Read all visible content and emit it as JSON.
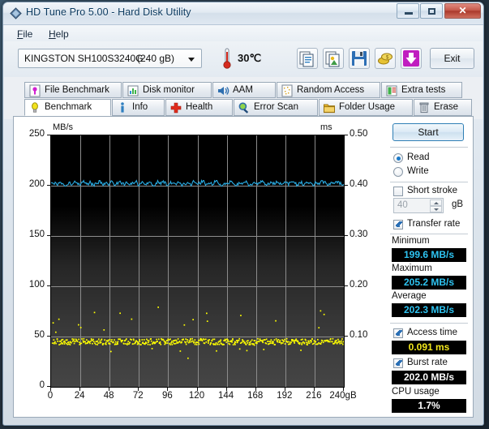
{
  "window": {
    "title": "HD Tune Pro 5.00 - Hard Disk Utility",
    "icon": "hdtune-logo-icon",
    "minimize_label": "",
    "maximize_label": "",
    "close_label": "✕"
  },
  "menu": {
    "items": [
      {
        "label": "File",
        "accel": "F"
      },
      {
        "label": "Help",
        "accel": "H"
      }
    ]
  },
  "toolbar": {
    "drive_name": "KINGSTON SH100S3240G",
    "drive_capacity": "(240 gB)",
    "temperature": "30℃",
    "thermometer_icon": "thermometer-icon",
    "buttons": [
      {
        "name": "copy-text-icon",
        "label": ""
      },
      {
        "name": "copy-image-icon",
        "label": ""
      },
      {
        "name": "save-icon",
        "label": ""
      },
      {
        "name": "coins-icon",
        "label": ""
      },
      {
        "name": "download-arrow-icon",
        "label": ""
      }
    ],
    "exit_label": "Exit"
  },
  "tabs": {
    "row1": [
      {
        "label": "File Benchmark",
        "icon": "file-benchmark-icon",
        "active": false
      },
      {
        "label": "Disk monitor",
        "icon": "disk-monitor-icon",
        "active": false
      },
      {
        "label": "AAM",
        "icon": "speaker-icon",
        "active": false
      },
      {
        "label": "Random Access",
        "icon": "random-access-icon",
        "active": false
      },
      {
        "label": "Extra tests",
        "icon": "extra-tests-icon",
        "active": false
      }
    ],
    "row2": [
      {
        "label": "Benchmark",
        "icon": "benchmark-bulb-icon",
        "active": true
      },
      {
        "label": "Info",
        "icon": "info-icon",
        "active": false
      },
      {
        "label": "Health",
        "icon": "health-cross-icon",
        "active": false
      },
      {
        "label": "Error Scan",
        "icon": "magnifier-icon",
        "active": false
      },
      {
        "label": "Folder Usage",
        "icon": "folder-icon",
        "active": false
      },
      {
        "label": "Erase",
        "icon": "trash-icon",
        "active": false
      }
    ]
  },
  "results": {
    "start_label": "Start",
    "mode": {
      "read_label": "Read",
      "write_label": "Write",
      "selected": "Read"
    },
    "short_stroke": {
      "label": "Short stroke",
      "checked": false,
      "value": "40",
      "unit": "gB"
    },
    "transfer_rate": {
      "label": "Transfer rate",
      "checked": true,
      "minimum_label": "Minimum",
      "minimum_value": "199.6 MB/s",
      "maximum_label": "Maximum",
      "maximum_value": "205.2 MB/s",
      "average_label": "Average",
      "average_value": "202.3 MB/s"
    },
    "access_time": {
      "label": "Access time",
      "checked": true,
      "value": "0.091 ms"
    },
    "burst_rate": {
      "label": "Burst rate",
      "checked": true,
      "value": "202.0 MB/s"
    },
    "cpu_usage": {
      "label": "CPU usage",
      "value": "1.7%"
    }
  },
  "colors": {
    "transfer_line": "#29abe2",
    "access_dots": "#ffff00",
    "value_cyan": "#2ec4f2",
    "value_yellow": "#f2e71c",
    "value_white": "#ffffff",
    "plot_background": "#000000",
    "gridline": "#8c8c8c"
  },
  "chart_data": {
    "type": "line",
    "title": "",
    "xlabel": "240gB",
    "ylabel": "MB/s",
    "y2label": "ms",
    "xlim": [
      0,
      240
    ],
    "ylim": [
      0,
      250
    ],
    "y2lim": [
      0,
      0.5
    ],
    "grid": true,
    "legend": "none",
    "xticks": [
      0,
      24,
      48,
      72,
      96,
      120,
      144,
      168,
      192,
      216,
      240
    ],
    "xticklabels": [
      "0",
      "24",
      "48",
      "72",
      "96",
      "120",
      "144",
      "168",
      "192",
      "216",
      "240gB"
    ],
    "yticks": [
      0,
      50,
      100,
      150,
      200,
      250
    ],
    "yticklabels": [
      "0",
      "50",
      "100",
      "150",
      "200",
      "250"
    ],
    "y2ticks": [
      0.1,
      0.2,
      0.3,
      0.4,
      0.5
    ],
    "y2ticklabels": [
      "0.10",
      "0.20",
      "0.30",
      "0.40",
      "0.50"
    ],
    "series": [
      {
        "name": "Transfer rate",
        "type": "line",
        "axis": "left",
        "unit": "MB/s",
        "color": "#29abe2",
        "minimum": 199.6,
        "maximum": 205.2,
        "average": 202.3,
        "x": [
          0,
          2,
          5,
          7,
          10,
          12,
          15,
          17,
          20,
          22,
          25,
          27,
          30,
          32,
          35,
          37,
          40,
          42,
          45,
          47,
          50,
          52,
          55,
          57,
          60,
          62,
          65,
          67,
          70,
          72,
          75,
          77,
          80,
          82,
          85,
          87,
          90,
          92,
          95,
          97,
          100,
          102,
          105,
          107,
          110,
          112,
          115,
          117,
          120,
          122,
          125,
          127,
          130,
          132,
          135,
          137,
          140,
          142,
          145,
          147,
          150,
          152,
          155,
          157,
          160,
          162,
          165,
          167,
          170,
          172,
          175,
          177,
          180,
          182,
          185,
          187,
          190,
          192,
          195,
          197,
          200,
          202,
          205,
          207,
          210,
          212,
          215,
          217,
          220,
          222,
          225,
          227,
          230,
          232,
          235,
          237,
          240
        ],
        "values": [
          201.8,
          203.4,
          200.9,
          204.1,
          202.0,
          199.8,
          203.8,
          201.2,
          204.6,
          200.4,
          202.7,
          205.0,
          201.1,
          203.2,
          199.9,
          202.5,
          204.3,
          200.7,
          203.0,
          201.6,
          204.8,
          200.2,
          202.9,
          203.7,
          200.6,
          204.2,
          201.4,
          202.1,
          205.1,
          199.7,
          203.5,
          201.0,
          204.0,
          202.3,
          200.1,
          203.9,
          201.7,
          204.4,
          200.5,
          202.6,
          203.1,
          201.3,
          204.9,
          199.6,
          202.2,
          203.6,
          200.8,
          204.5,
          201.9,
          202.4,
          205.2,
          200.3,
          203.3,
          201.5,
          204.7,
          202.8,
          200.0,
          203.0,
          201.1,
          204.1,
          202.5,
          199.9,
          203.7,
          201.8,
          204.3,
          200.4,
          202.0,
          203.4,
          201.2,
          204.6,
          202.7,
          200.9,
          203.8,
          201.6,
          204.0,
          202.1,
          200.6,
          203.2,
          201.4,
          204.4,
          202.9,
          200.2,
          203.5,
          201.0,
          204.2,
          202.3,
          199.8,
          203.1,
          201.7,
          204.8,
          202.6,
          200.5,
          203.9,
          201.3,
          204.5,
          202.2,
          201.5
        ]
      },
      {
        "name": "Access time",
        "type": "scatter",
        "axis": "right",
        "unit": "ms",
        "color": "#ffff00",
        "average": 0.091,
        "band_center": 0.091,
        "band_spread": 0.012,
        "outlier_max": 0.16,
        "point_count": 520
      }
    ]
  }
}
